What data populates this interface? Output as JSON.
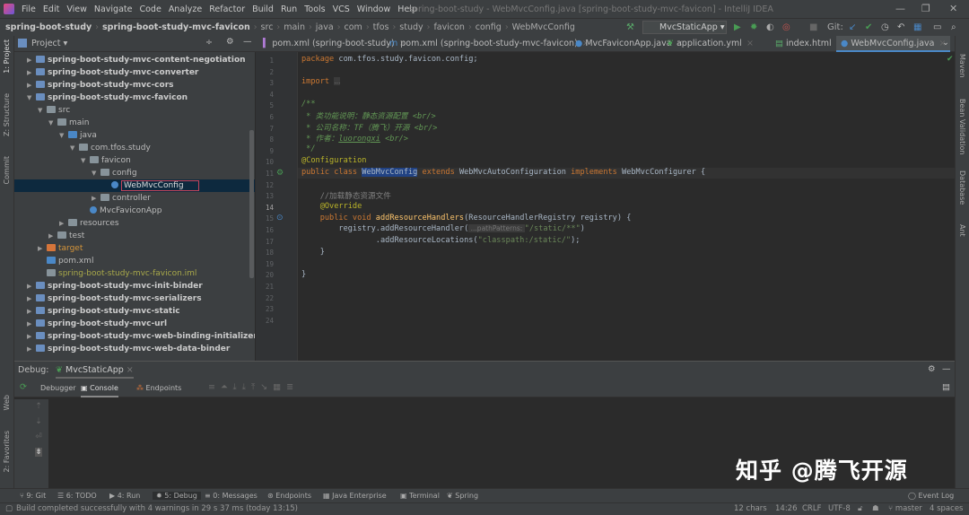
{
  "window": {
    "title": "spring-boot-study - WebMvcConfig.java [spring-boot-study-mvc-favicon] - IntelliJ IDEA",
    "minimize": "—",
    "restore": "❐",
    "close": "✕"
  },
  "menu": [
    "File",
    "Edit",
    "View",
    "Navigate",
    "Code",
    "Analyze",
    "Refactor",
    "Build",
    "Run",
    "Tools",
    "VCS",
    "Window",
    "Help"
  ],
  "breadcrumb": [
    "spring-boot-study",
    "spring-boot-study-mvc-favicon",
    "src",
    "main",
    "java",
    "com",
    "tfos",
    "study",
    "favicon",
    "config",
    "WebMvcConfig"
  ],
  "toolbar": {
    "run_config": "MvcStaticApp",
    "git_label": "Git:"
  },
  "project_panel": {
    "title": "Project ▾"
  },
  "editor_tabs": [
    {
      "label": "pom.xml (spring-boot-study)"
    },
    {
      "label": "pom.xml (spring-boot-study-mvc-favicon)"
    },
    {
      "label": "MvcFaviconApp.java"
    },
    {
      "label": "application.yml"
    },
    {
      "label": "index.html"
    },
    {
      "label": "WebMvcConfig.java",
      "active": true
    }
  ],
  "tree": [
    {
      "label": "spring-boot-study-mvc-content-negotiation",
      "level": 1,
      "arrow": "▶",
      "type": "module"
    },
    {
      "label": "spring-boot-study-mvc-converter",
      "level": 1,
      "arrow": "▶",
      "type": "module"
    },
    {
      "label": "spring-boot-study-mvc-cors",
      "level": 1,
      "arrow": "▶",
      "type": "module"
    },
    {
      "label": "spring-boot-study-mvc-favicon",
      "level": 1,
      "arrow": "▼",
      "type": "module"
    },
    {
      "label": "src",
      "level": 2,
      "arrow": "▼",
      "type": "folder"
    },
    {
      "label": "main",
      "level": 3,
      "arrow": "▼",
      "type": "folder"
    },
    {
      "label": "java",
      "level": 4,
      "arrow": "▼",
      "type": "src"
    },
    {
      "label": "com.tfos.study",
      "level": 5,
      "arrow": "▼",
      "type": "folder"
    },
    {
      "label": "favicon",
      "level": 6,
      "arrow": "▼",
      "type": "folder"
    },
    {
      "label": "config",
      "level": 7,
      "arrow": "▼",
      "type": "folder"
    },
    {
      "label": "WebMvcConfig",
      "level": 8,
      "arrow": "",
      "type": "class",
      "selected": true
    },
    {
      "label": "controller",
      "level": 7,
      "arrow": "▶",
      "type": "folder"
    },
    {
      "label": "MvcFaviconApp",
      "level": 6,
      "arrow": "",
      "type": "class"
    },
    {
      "label": "resources",
      "level": 4,
      "arrow": "▶",
      "type": "folder"
    },
    {
      "label": "test",
      "level": 3,
      "arrow": "▶",
      "type": "folder"
    },
    {
      "label": "target",
      "level": 2,
      "arrow": "▶",
      "type": "target"
    },
    {
      "label": "pom.xml",
      "level": 2,
      "arrow": "",
      "type": "maven"
    },
    {
      "label": "spring-boot-study-mvc-favicon.iml",
      "level": 2,
      "arrow": "",
      "type": "iml"
    },
    {
      "label": "spring-boot-study-mvc-init-binder",
      "level": 1,
      "arrow": "▶",
      "type": "module"
    },
    {
      "label": "spring-boot-study-mvc-serializers",
      "level": 1,
      "arrow": "▶",
      "type": "module"
    },
    {
      "label": "spring-boot-study-mvc-static",
      "level": 1,
      "arrow": "▶",
      "type": "module"
    },
    {
      "label": "spring-boot-study-mvc-url",
      "level": 1,
      "arrow": "▶",
      "type": "module"
    },
    {
      "label": "spring-boot-study-mvc-web-binding-initializer",
      "level": 1,
      "arrow": "▶",
      "type": "module"
    },
    {
      "label": "spring-boot-study-mvc-web-data-binder",
      "level": 1,
      "arrow": "▶",
      "type": "module"
    }
  ],
  "code": {
    "l1a": "package",
    "l1b": " com.tfos.study.favicon.config;",
    "l3a": "import",
    "l3b": "...",
    "l8": "/**",
    "l9": " * 类功能说明：静态资源配置 <br/>",
    "l10": " * 公司名称：TF（腾飞）开源 <br/>",
    "l11a": " * 作者：",
    "l11b": "luorongxi",
    "l11c": " <br/>",
    "l12": " */",
    "l13": "@Configuration",
    "l14a": "public class ",
    "l14b": "WebMvcConfig",
    "l14c": " extends ",
    "l14d": "WebMvcAutoConfiguration",
    "l14e": " implements ",
    "l14f": "WebMvcConfigurer {",
    "l16": "    //加载静态资源文件",
    "l17": "    @Override",
    "l18a": "    public void ",
    "l18b": "addResourceHandlers",
    "l18c": "(ResourceHandlerRegistry registry) {",
    "l19a": "        registry.addResourceHandler(",
    "l19hint": " ...pathPatterns: ",
    "l19b": "\"/static/**\"",
    "l19c": ")",
    "l20a": "                .addResourceLocations(",
    "l20b": "\"classpath:/static/\"",
    "l20c": ");",
    "l21": "    }",
    "l23": "}"
  },
  "debug": {
    "label": "Debug:",
    "session": "MvcStaticApp",
    "tabs": [
      "Debugger",
      "Console",
      "Endpoints"
    ]
  },
  "left_stripe": [
    "1: Project",
    "Z: Structure",
    "Commit",
    "Web",
    "2: Favorites"
  ],
  "right_stripe": [
    "Maven",
    "Bean Validation",
    "Database",
    "Ant"
  ],
  "bottom_tools": [
    "9: Git",
    "6: TODO",
    "4: Run",
    "5: Debug",
    "0: Messages",
    "Endpoints",
    "Java Enterprise",
    "Terminal",
    "Spring"
  ],
  "event_log": "Event Log",
  "status": {
    "message": "Build completed successfully with 4 warnings in 29 s 37 ms (today 13:15)",
    "chars": "12 chars",
    "position": "14:26",
    "line_sep": "CRLF",
    "encoding": "UTF-8",
    "branch": "master",
    "indent": "4 spaces"
  },
  "watermark": "知乎 @腾飞开源"
}
